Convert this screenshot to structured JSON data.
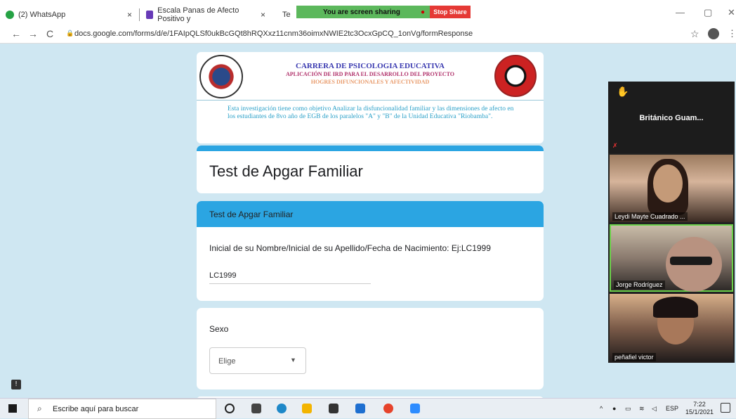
{
  "browser": {
    "tabs": [
      {
        "label": "(2) WhatsApp",
        "close": "×"
      },
      {
        "label": "Escala Panas de Afecto Positivo y",
        "close": "×"
      },
      {
        "label": "Te"
      }
    ],
    "screen_share": {
      "text": "You are screen sharing",
      "stop": "Stop Share"
    },
    "window_controls": {
      "minimize": "—",
      "maximize": "▢",
      "close": "✕"
    },
    "nav": {
      "back": "←",
      "forward": "→",
      "reload": "C"
    },
    "url": "docs.google.com/forms/d/e/1FAIpQLSf0ukBcGQt8hRQXxz11cnm36oimxNWIE2tc3OcxGpCQ_1onVg/formResponse",
    "star": "☆",
    "menu": "⋮"
  },
  "form_header": {
    "line1": "CARRERA DE PSICOLOGIA EDUCATIVA",
    "line2": "APLICACIÓN DE IRD PARA EL DESARROLLO DEL PROYECTO",
    "line3": "HOGRES DIFUNCIONALES Y AFECTIVIDAD",
    "description": "Esta investigación tiene como objetivo Analizar la disfuncionalidad familiar y las dimensiones de afecto en los estudiantes de 8vo año de EGB de los paralelos \"A\" y \"B\" de la Unidad Educativa \"Riobamba\"."
  },
  "form": {
    "title": "Test de Apgar Familiar",
    "section_title": "Test de Apgar Familiar",
    "question1": {
      "label": "Inicial de su Nombre/Inicial de su Apellido/Fecha de Nacimiento: Ej:LC1999",
      "answer": "LC1999"
    },
    "question2": {
      "label": "Sexo",
      "dropdown_value": "Elige"
    }
  },
  "zoom": {
    "active_speaker": "Británico  Guam...",
    "participants": [
      {
        "name": "Leydi Mayte Cuadrado ..."
      },
      {
        "name": "Jorge Rodríguez"
      },
      {
        "name": "peñafiel victor"
      }
    ]
  },
  "taskbar": {
    "search_placeholder": "Escribe aquí para buscar",
    "language": "ESP",
    "time": "7:22",
    "date": "15/1/2021"
  },
  "colors": {
    "accent": "#2ba5e2",
    "page_bg": "#cfe7f2",
    "share_green": "#5cb85c",
    "stop_red": "#e53935"
  }
}
